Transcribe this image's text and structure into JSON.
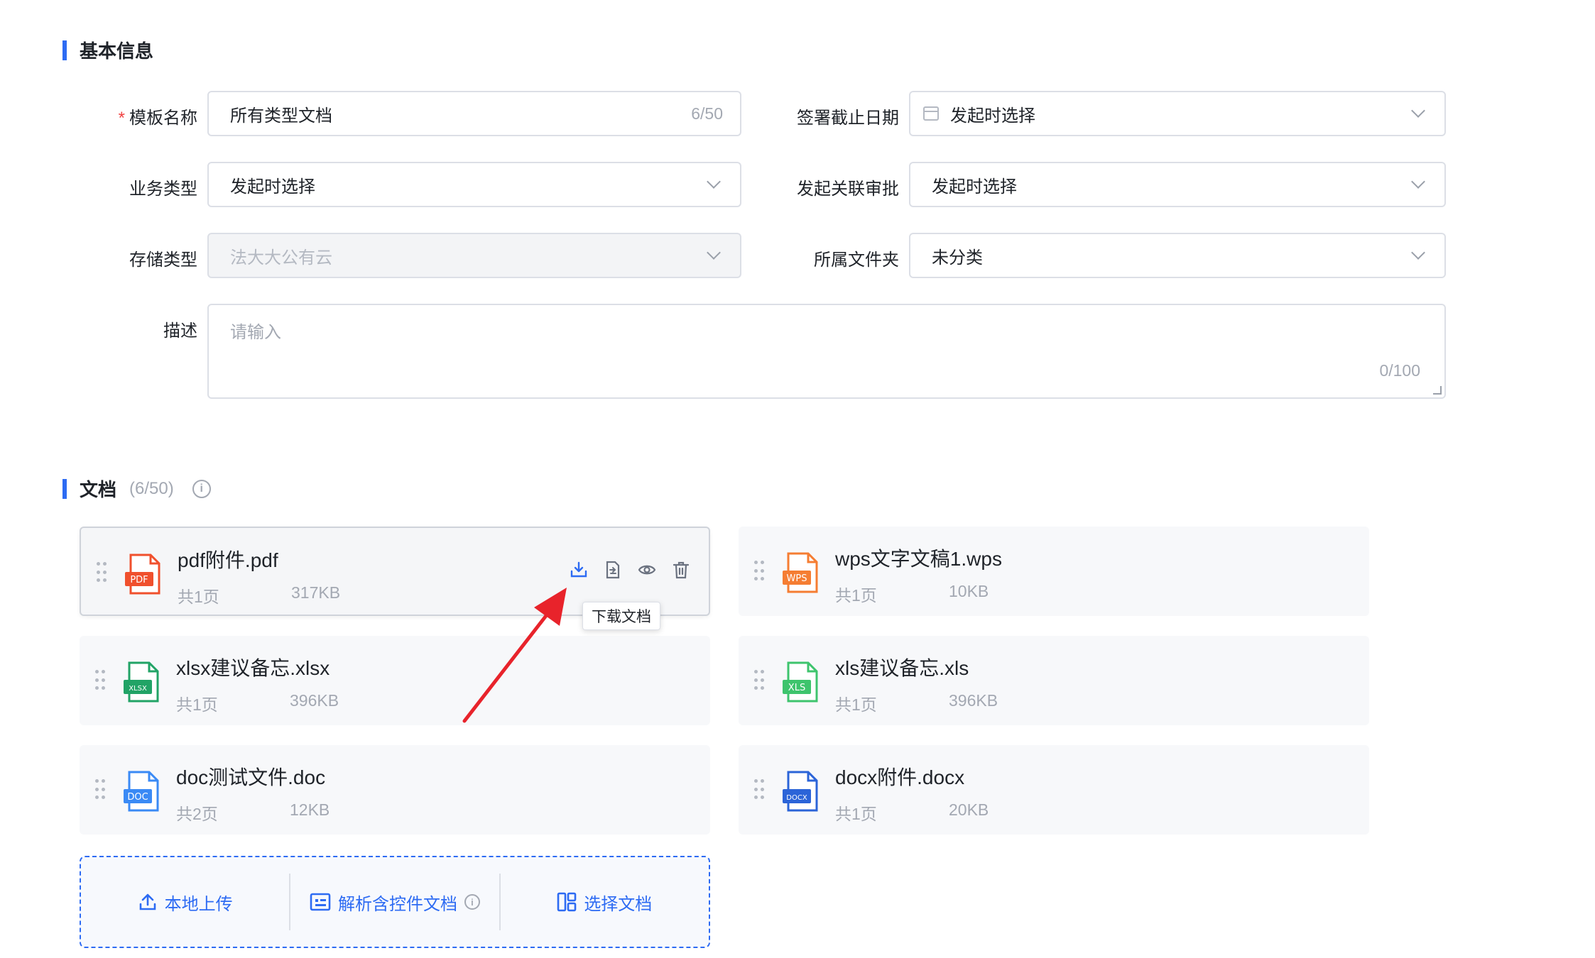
{
  "basic_section": {
    "title": "基本信息"
  },
  "form": {
    "template_name": {
      "label": "模板名称",
      "required_mark": "*",
      "value": "所有类型文档",
      "counter": "6/50"
    },
    "sign_deadline": {
      "label": "签署截止日期",
      "value": "发起时选择"
    },
    "business_type": {
      "label": "业务类型",
      "value": "发起时选择"
    },
    "related_approval": {
      "label": "发起关联审批",
      "value": "发起时选择"
    },
    "storage_type": {
      "label": "存储类型",
      "value": "法大大公有云"
    },
    "folder": {
      "label": "所属文件夹",
      "value": "未分类"
    },
    "description": {
      "label": "描述",
      "placeholder": "请输入",
      "counter": "0/100"
    }
  },
  "docs_section": {
    "title": "文档",
    "count": "(6/50)",
    "info_icon": "info-icon"
  },
  "documents": [
    {
      "name": "pdf附件.pdf",
      "pages": "共1页",
      "size": "317KB",
      "type": "PDF",
      "color": "#f0502d"
    },
    {
      "name": "wps文字文稿1.wps",
      "pages": "共1页",
      "size": "10KB",
      "type": "WPS",
      "color": "#f57d32"
    },
    {
      "name": "xlsx建议备忘.xlsx",
      "pages": "共1页",
      "size": "396KB",
      "type": "XLSX",
      "color": "#21a366"
    },
    {
      "name": "xls建议备忘.xls",
      "pages": "共1页",
      "size": "396KB",
      "type": "XLS",
      "color": "#3ec46d"
    },
    {
      "name": "doc测试文件.doc",
      "pages": "共2页",
      "size": "12KB",
      "type": "DOC",
      "color": "#3a8af5"
    },
    {
      "name": "docx附件.docx",
      "pages": "共1页",
      "size": "20KB",
      "type": "DOCX",
      "color": "#2b64d8"
    }
  ],
  "tooltip": {
    "text": "下载文档"
  },
  "upload": {
    "local_upload": "本地上传",
    "parse_controls": "解析含控件文档",
    "select_doc": "选择文档"
  },
  "colors": {
    "accent": "#2d6bf3",
    "arrow": "#e8232b"
  }
}
